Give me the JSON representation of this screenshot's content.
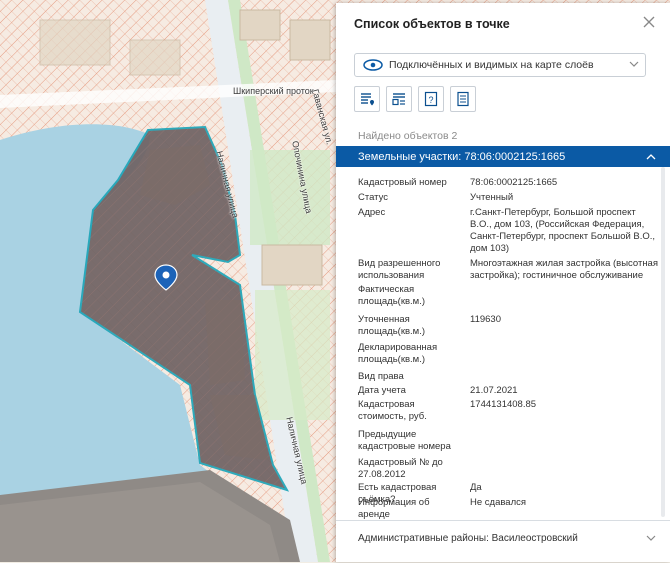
{
  "map": {
    "streets": {
      "shkipersky": "Шкиперский проток",
      "gavanskaya": "Гаванская ул.",
      "nalichnaya1": "Наличная улица",
      "nalichnaya2": "Наличная улица",
      "opochinina": "Опочинина улица"
    },
    "marker": "location-pin",
    "colors": {
      "water": "#a9d2e3",
      "parcel_border": "#1e9bb0",
      "parcel_fill": "#5b4f4f",
      "hatch": "#e08060"
    }
  },
  "panel": {
    "title": "Список объектов в точке",
    "layer_select": {
      "value": "Подключённых и видимых на карте слоёв"
    },
    "toolbar_icons": [
      "layers-pin-icon",
      "layers-list-icon",
      "unknown-object-icon",
      "document-icon"
    ],
    "found_count": "Найдено объектов 2",
    "section": {
      "title": "Земельные участки: 78:06:0002125:1665"
    },
    "attributes": [
      {
        "k": "Кадастровый номер",
        "v": "78:06:0002125:1665"
      },
      {
        "k": "Статус",
        "v": "Учтенный"
      },
      {
        "k": "Адрес",
        "v": "г.Санкт-Петербург, Большой проспект В.О., дом 103, (Российская Федерация, Санкт-Петербург, проспект Большой В.О., дом 103)"
      },
      {
        "k": "Вид разрешенного использования",
        "v": "Многоэтажная жилая застройка (высотная застройка); гостиничное обслуживание"
      },
      {
        "k": "Фактическая площадь(кв.м.)",
        "v": ""
      },
      {
        "k": "Уточненная площадь(кв.м.)",
        "v": "119630"
      },
      {
        "k": "Декларированная площадь(кв.м.)",
        "v": ""
      },
      {
        "k": "Вид права",
        "v": ""
      },
      {
        "k": "Дата учета",
        "v": "21.07.2021"
      },
      {
        "k": "Кадастровая стоимость, руб.",
        "v": "1744131408.85"
      },
      {
        "k": "Предыдущие кадастровые номера",
        "v": ""
      },
      {
        "k": "Кадастровый № до 27.08.2012",
        "v": ""
      },
      {
        "k": "Есть кадастровая съёмка?",
        "v": "Да"
      },
      {
        "k": "Информация об аренде",
        "v": "Не сдавался"
      }
    ],
    "footer_section": {
      "title": "Административные районы: Василеостровский"
    },
    "accent": "#0b5aa5"
  }
}
